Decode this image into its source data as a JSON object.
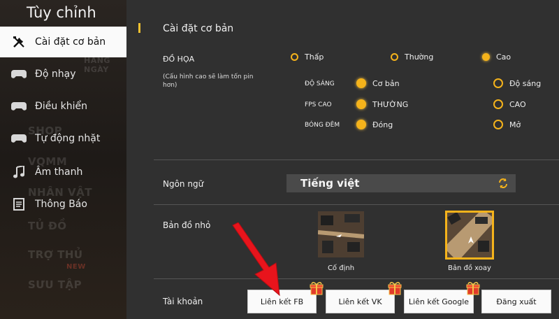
{
  "sidebar": {
    "title": "Tùy chỉnh",
    "items": [
      {
        "label": "Cài đặt cơ bản",
        "icon": "wrench-screwdriver-icon",
        "active": true
      },
      {
        "label": "Độ nhạy",
        "icon": "gamepad-icon"
      },
      {
        "label": "Điều khiển",
        "icon": "gamepad-icon"
      },
      {
        "label": "Tự động nhặt",
        "icon": "gamepad-icon"
      },
      {
        "label": "Âm thanh",
        "icon": "music-note-icon"
      },
      {
        "label": "Thông Báo",
        "icon": "document-icon"
      }
    ],
    "background_texts": [
      "HÀNG NGÀY",
      "SHOP",
      "VQMM",
      "NHÂN VẬT",
      "TỦ ĐỒ",
      "TRỢ THỦ",
      "SƯU TẬP",
      "NEW"
    ]
  },
  "section": {
    "title": "Cài đặt cơ bản"
  },
  "graphics": {
    "label": "ĐỒ HỌA",
    "note": "(Cấu hình cao sẽ làm tốn pin hơn)",
    "options": [
      {
        "label": "Thấp",
        "selected": false
      },
      {
        "label": "Thường",
        "selected": false
      },
      {
        "label": "Cao",
        "selected": true
      }
    ],
    "rows": [
      {
        "label": "ĐỘ SÁNG",
        "left": "Cơ bản",
        "right": "Độ sáng",
        "left_selected": true
      },
      {
        "label": "FPS CAO",
        "left": "THƯỜNG",
        "right": "CAO",
        "left_selected": true
      },
      {
        "label": "BÓNG ĐÊM",
        "left": "Đóng",
        "right": "Mở",
        "left_selected": true
      }
    ]
  },
  "language": {
    "label": "Ngôn ngữ",
    "value": "Tiếng việt"
  },
  "minimap": {
    "label": "Bản đồ nhỏ",
    "options": [
      {
        "caption": "Cố định",
        "selected": false
      },
      {
        "caption": "Bản đồ xoay",
        "selected": true
      }
    ]
  },
  "account": {
    "label": "Tài khoản",
    "buttons": [
      "Liên kết FB",
      "Liên kết VK",
      "Liên kết Google",
      "Đăng xuất"
    ]
  },
  "colors": {
    "accent": "#f5b31b",
    "arrow": "#e8141c",
    "panel": "#303030",
    "sidebar_active": "#fafafa"
  }
}
